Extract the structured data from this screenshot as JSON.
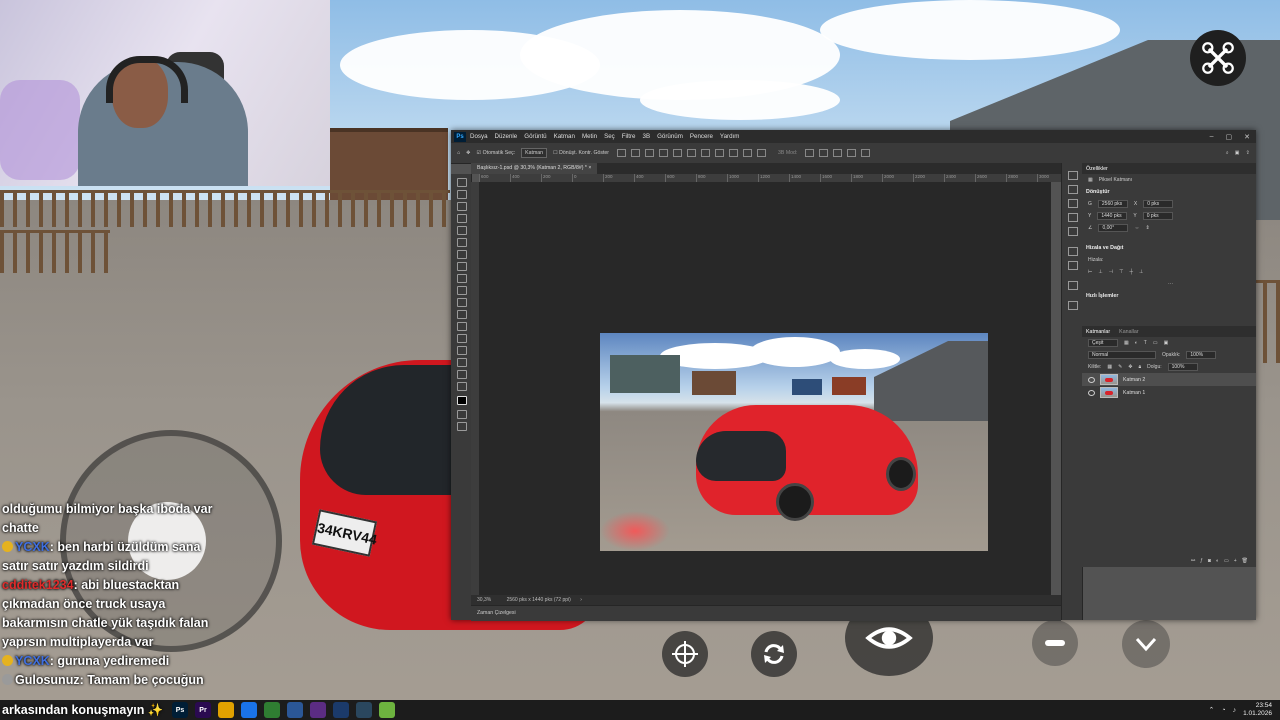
{
  "game": {
    "plate": "34KRV44",
    "controls": {
      "target_icon": "crosshair-icon",
      "swap_icon": "rotate-arrows-icon",
      "camera_icon": "eye-icon",
      "brake_icon": "minus-icon",
      "down_icon": "chevron-down-icon",
      "drone_icon": "drone-icon"
    }
  },
  "chat": {
    "lines": [
      {
        "user": "",
        "text": "olduğumu bilmiyor başka iboda var"
      },
      {
        "user": "",
        "text": "chatte"
      },
      {
        "user": "YCXK",
        "sep": ":",
        "text": " ben harbi üzüldüm sana"
      },
      {
        "user": "",
        "text": "satır satır yazdım sildirdi"
      },
      {
        "user": "cdditek1234",
        "sep": ":",
        "text": " abi bluestacktan"
      },
      {
        "user": "",
        "text": "çıkmadan önce truck usaya"
      },
      {
        "user": "",
        "text": "bakarmısın chatle yük taşıdık falan"
      },
      {
        "user": "",
        "text": "yaprsın multiplayerda var"
      },
      {
        "user": "YCXK",
        "sep": ":",
        "text": " guruna yediremedi"
      },
      {
        "user": "Gulosunuz",
        "sep": ":",
        "text": " Tamam be çocuğun"
      }
    ]
  },
  "photoshop": {
    "menu": [
      "Dosya",
      "Düzenle",
      "Görüntü",
      "Katman",
      "Metin",
      "Seç",
      "Filtre",
      "3B",
      "Görünüm",
      "Pencere",
      "Yardım"
    ],
    "options": {
      "auto_select": "Otomatik Seç:",
      "layer_select": "Katman",
      "transform": "Dönüşt. Kontr. Göster",
      "mode_3d": "3B Mod:"
    },
    "document_tab": "Başlıksız-1.psd @ 30,3% (Katman 2, RGB/8#) *",
    "ruler_ticks": [
      "600",
      "400",
      "200",
      "0",
      "200",
      "400",
      "600",
      "800",
      "1000",
      "1200",
      "1400",
      "1600",
      "1800",
      "2000",
      "2200",
      "2400",
      "2600",
      "2800",
      "3000"
    ],
    "status": {
      "zoom": "30,3%",
      "dimensions": "2560 pks x 1440 pks (72 ppi)"
    },
    "timeline_label": "Zaman Çizelgesi",
    "properties": {
      "tab": "Özellikler",
      "layer_kind": "Piksel Katmanı",
      "transform_heading": "Dönüştür",
      "w_label": "G",
      "w": "2560 pks",
      "h_label": "Y",
      "h": "1440 pks",
      "x_label": "X",
      "x": "0 pks",
      "y_label": "Y",
      "y": "0 pks",
      "angle": "0,00°",
      "align_heading": "Hizala ve Dağıt",
      "align_sub": "Hizala:",
      "quick_heading": "Hızlı İşlemler"
    },
    "layers_panel": {
      "tab_active": "Katmanlar",
      "tab_other": "Kanallar",
      "filter": "Çeşit",
      "blend": "Normal",
      "opacity_label": "Opaklık:",
      "opacity": "100%",
      "lock_label": "Kilitle:",
      "fill_label": "Dolgu:",
      "fill": "100%",
      "layers": [
        {
          "name": "Katman 2",
          "selected": true
        },
        {
          "name": "Katman 1",
          "selected": false
        }
      ]
    }
  },
  "taskbar": {
    "overlay_text": "arkasından konuşmayın ✨",
    "apps": [
      {
        "label": "Ps",
        "color": "#001e36"
      },
      {
        "label": "Pr",
        "color": "#2a0a50"
      },
      {
        "label": "",
        "color": "#e0a100"
      },
      {
        "label": "",
        "color": "#1a73e8"
      },
      {
        "label": "",
        "color": "#2f7d32"
      },
      {
        "label": "",
        "color": "#2b5797"
      },
      {
        "label": "",
        "color": "#5b2c83"
      },
      {
        "label": "",
        "color": "#1b3a6a"
      },
      {
        "label": "",
        "color": "#2a475e"
      },
      {
        "label": "",
        "color": "#6db33f"
      }
    ],
    "time": "23:54",
    "date": "1.01.2026"
  }
}
